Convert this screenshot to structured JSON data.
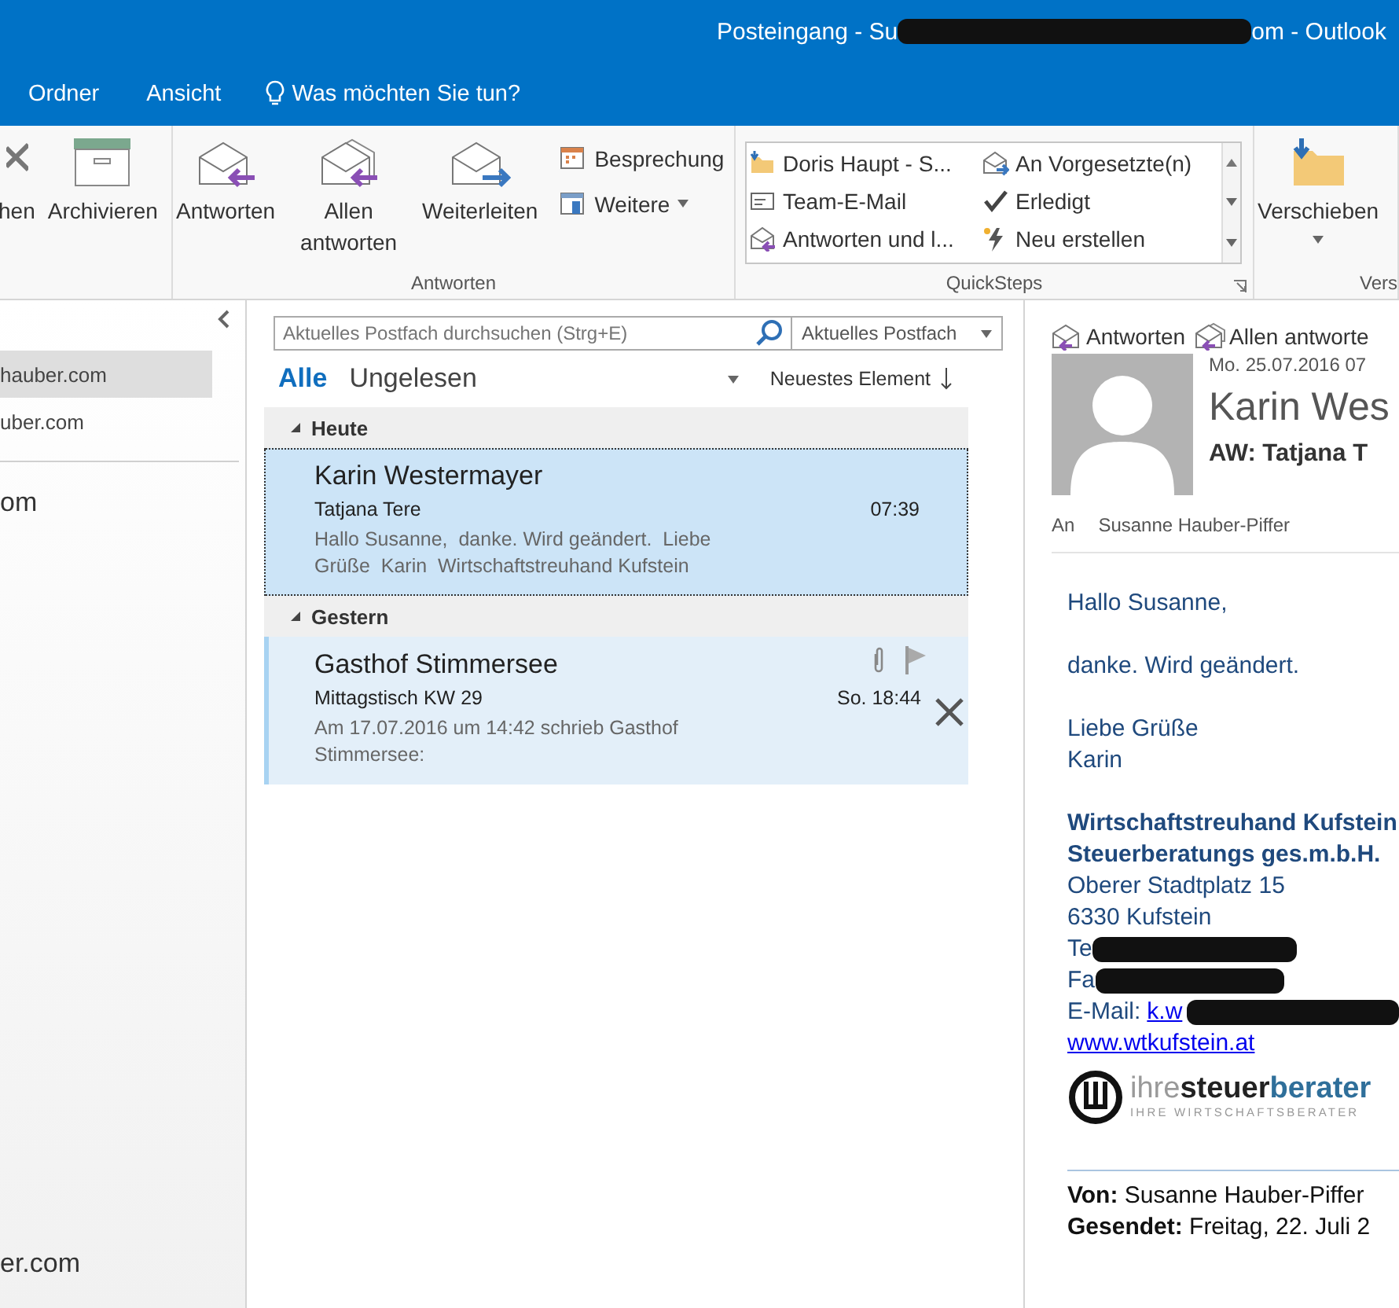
{
  "window": {
    "title_start": "Posteingang - Su",
    "title_end": "om - Outlook"
  },
  "menu": [
    {
      "label": "Ordner"
    },
    {
      "label": "Ansicht"
    }
  ],
  "tell_me": "Was möchten Sie tun?",
  "ribbon": {
    "groups": [
      {
        "large": [
          {
            "label": "hen"
          },
          {
            "label": "Archivieren"
          }
        ]
      },
      {
        "large": [
          {
            "label": "Antworten"
          },
          {
            "label": "Allen\nantworten"
          },
          {
            "label": "Weiterleiten"
          }
        ],
        "small": [
          {
            "label": "Besprechung",
            "dropdown": false
          },
          {
            "label": "Weitere",
            "dropdown": true
          }
        ],
        "label": "Antworten"
      },
      {
        "quicksteps": [
          "Doris Haupt - S...",
          "An Vorgesetzte(n)",
          "Team-E-Mail",
          "Erledigt",
          "Antworten und l...",
          "Neu erstellen"
        ],
        "label": "QuickSteps"
      },
      {
        "large": [
          {
            "label": "Verschieben",
            "dropdown": true
          }
        ],
        "label": "Vers"
      }
    ]
  },
  "folder_pane": {
    "items": [
      {
        "label": "hauber.com",
        "selected": true
      },
      {
        "label": "uber.com",
        "selected": false
      }
    ],
    "account": "om",
    "bottom_account": "er.com"
  },
  "message_list": {
    "search": {
      "placeholder": "Aktuelles Postfach durchsuchen (Strg+E)",
      "scope": "Aktuelles Postfach"
    },
    "filters": [
      {
        "label": "Alle",
        "selected": true
      },
      {
        "label": "Ungelesen",
        "selected": false
      }
    ],
    "sort": "Neuestes Element",
    "groups": [
      {
        "label": "Heute",
        "expanded": true,
        "messages": [
          {
            "sender": "Karin Westermayer",
            "subject": "Tatjana Tere",
            "preview": "Hallo Susanne,  danke. Wird geändert.  Liebe\nGrüße  Karin  Wirtschaftstreuhand Kufstein",
            "time": "07:39",
            "selected": true,
            "hovered": false,
            "attachment": false
          }
        ]
      },
      {
        "label": "Gestern",
        "expanded": true,
        "messages": [
          {
            "sender": "Gasthof Stimmersee",
            "subject": "Mittagstisch KW 29",
            "preview": "Am 17.07.2016 um 14:42 schrieb Gasthof\nStimmersee:",
            "time": "So. 18:44",
            "selected": false,
            "hovered": true,
            "attachment": true
          }
        ]
      }
    ]
  },
  "reading_pane": {
    "actions": [
      {
        "label": "Antworten"
      },
      {
        "label": "Allen antworte"
      }
    ],
    "date": "Mo. 25.07.2016 07",
    "sender": "Karin Wes",
    "subject": "AW: Tatjana T",
    "to_label": "An",
    "to": "Susanne Hauber-Piffer",
    "body": [
      {
        "kind": "para",
        "lines": [
          "Hallo Susanne,"
        ]
      },
      {
        "kind": "para",
        "lines": [
          "danke. Wird geändert."
        ]
      },
      {
        "kind": "para",
        "lines": [
          "Liebe Grüße",
          "Karin"
        ]
      }
    ],
    "signature": {
      "company": [
        "Wirtschaftstreuhand Kufstein",
        "Steuerberatungs ges.m.b.H."
      ],
      "address": [
        "Oberer Stadtplatz 15",
        "6330 Kufstein"
      ],
      "phone": "Te",
      "fax": "Fa",
      "email_label": "E-Mail: ",
      "email": "k.w",
      "website": "www.wtkufstein.at",
      "logo": {
        "parts": [
          "ihre",
          "steuer",
          "berater"
        ],
        "tagline": "IHRE WIRTSCHAFTSBERATER"
      }
    },
    "quoted": [
      {
        "label": "Von:",
        "value": "Susanne Hauber-Piffer"
      },
      {
        "label": "Gesendet:",
        "value": "Freitag, 22. Juli 2"
      }
    ]
  }
}
